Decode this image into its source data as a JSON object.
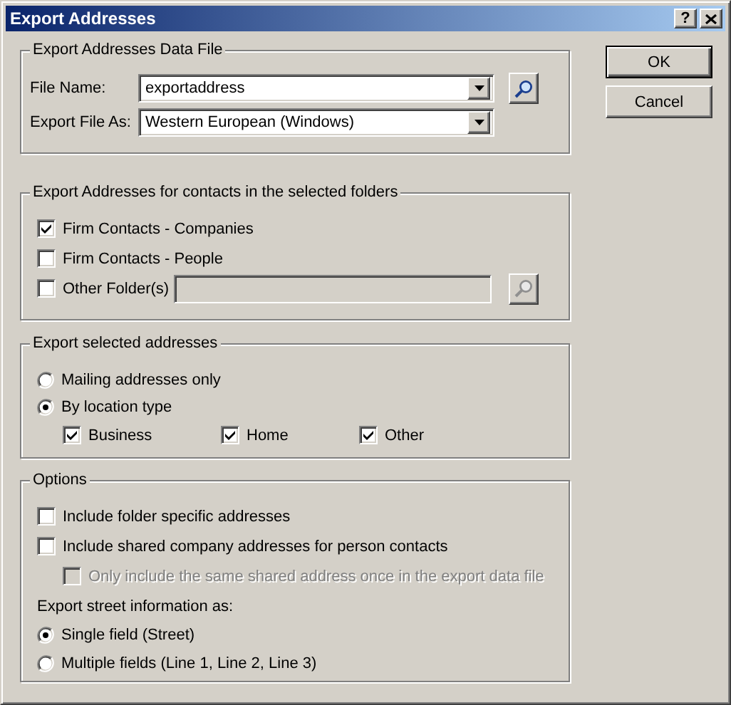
{
  "window": {
    "title": "Export Addresses",
    "help": "?"
  },
  "data_file": {
    "title": "Export Addresses Data File",
    "fields": [
      {
        "label": "File Name:",
        "value": "exportaddress",
        "kind": "browse"
      },
      {
        "label": "Export File As:",
        "value": "Western European (Windows)",
        "kind": "plain"
      }
    ]
  },
  "folders": {
    "title": "Export Addresses for contacts in the selected folders",
    "items": [
      {
        "label": "Firm Contacts - Companies",
        "checked": true,
        "kind": "check"
      },
      {
        "label": "Firm Contacts - People",
        "checked": false,
        "kind": "check"
      },
      {
        "label": "Other Folder(s)",
        "checked": false,
        "kind": "folder-field",
        "disabled": true
      }
    ]
  },
  "export_selected": {
    "title": "Export selected addresses",
    "options": [
      {
        "label": "Mailing addresses only",
        "selected": false
      },
      {
        "label": "By location type",
        "selected": true
      }
    ],
    "location_types": [
      {
        "label": "Business",
        "checked": true
      },
      {
        "label": "Home",
        "checked": true
      },
      {
        "label": "Other",
        "checked": true
      }
    ]
  },
  "options": {
    "title": "Options",
    "checks": [
      {
        "label": "Include folder specific addresses",
        "checked": false,
        "disabled": false
      },
      {
        "label": "Include shared company addresses for person contacts",
        "checked": false,
        "disabled": false,
        "children": [
          {
            "label": "Only include the same shared address once in the export data file",
            "checked": false,
            "disabled": true
          }
        ]
      }
    ],
    "street_label": "Export street information as:",
    "street_options": [
      {
        "label": "Single field (Street)",
        "selected": true
      },
      {
        "label": "Multiple fields (Line 1, Line 2, Line 3)",
        "selected": false
      }
    ]
  },
  "buttons": [
    {
      "label": "OK",
      "default": true
    },
    {
      "label": "Cancel",
      "default": false
    }
  ]
}
